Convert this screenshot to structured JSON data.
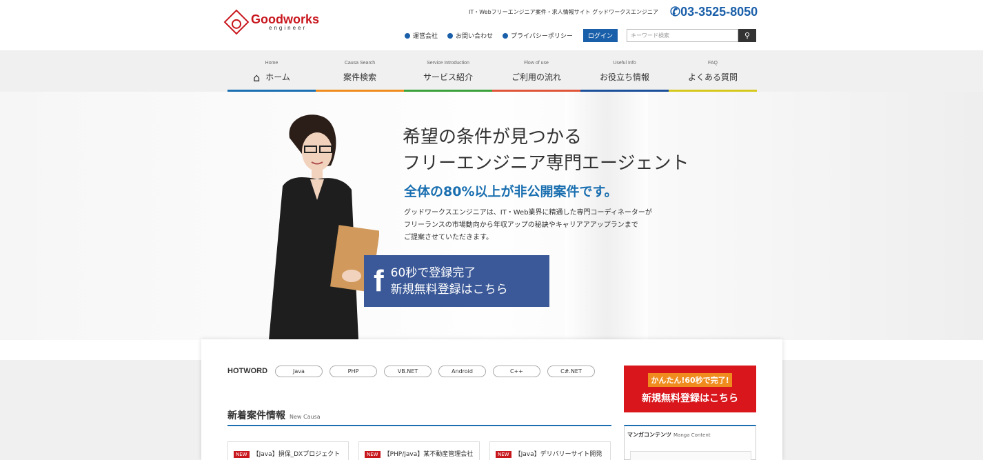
{
  "header": {
    "logo_title": "Goodworks",
    "logo_sub": "engineer",
    "tagline": "IT・Webフリーエンジニア案件・求人情報サイト グッドワークスエンジニア",
    "phone": "03-3525-8050",
    "links": [
      "運営会社",
      "お問い合わせ",
      "プライバシーポリシー"
    ],
    "login_label": "ログイン",
    "search_placeholder": "キーワード検索"
  },
  "nav": {
    "items": [
      {
        "en": "Home",
        "jp": "ホーム",
        "color": "#1a6fb0"
      },
      {
        "en": "Causa Search",
        "jp": "案件検索",
        "color": "#f08c1e"
      },
      {
        "en": "Service Introduction",
        "jp": "サービス紹介",
        "color": "#3aa23a"
      },
      {
        "en": "Flow of use",
        "jp": "ご利用の流れ",
        "color": "#e0553a"
      },
      {
        "en": "Useful Info",
        "jp": "お役立ち情報",
        "color": "#1a4f9a"
      },
      {
        "en": "FAQ",
        "jp": "よくある質問",
        "color": "#d7c81e"
      }
    ]
  },
  "hero": {
    "heading_line1": "希望の条件が見つかる",
    "heading_line2": "フリーエンジニア専門エージェント",
    "subheading": "全体の80%以上が非公開案件です。",
    "desc_line1": "グッドワークスエンジニアは、IT・Web業界に精通した専門コーディネーターが",
    "desc_line2": "フリーランスの市場動向から年収アップの秘訣やキャリアアアップランまで",
    "desc_line3": "ご提案させていただきます。",
    "fb_line1": "60秒で登録完了",
    "fb_line2": "新規無料登録はこちら"
  },
  "hotword": {
    "label": "HOTWORD",
    "tags": [
      "Java",
      "PHP",
      "VB.NET",
      "Android",
      "C++",
      "C#.NET"
    ]
  },
  "new_cases": {
    "title": "新着案件情報",
    "title_en": "New Causa",
    "badge": "NEW",
    "items": [
      "【Java】損保_DXプロジェクト",
      "【PHP/Java】某不動産管理会社",
      "【Java】デリバリーサイト開発"
    ]
  },
  "register": {
    "top": "かんたん!60秒で完了!",
    "main": "新規無料登録はこちら"
  },
  "manga": {
    "title": "マンガコンテンツ",
    "title_en": "Manga Content"
  }
}
